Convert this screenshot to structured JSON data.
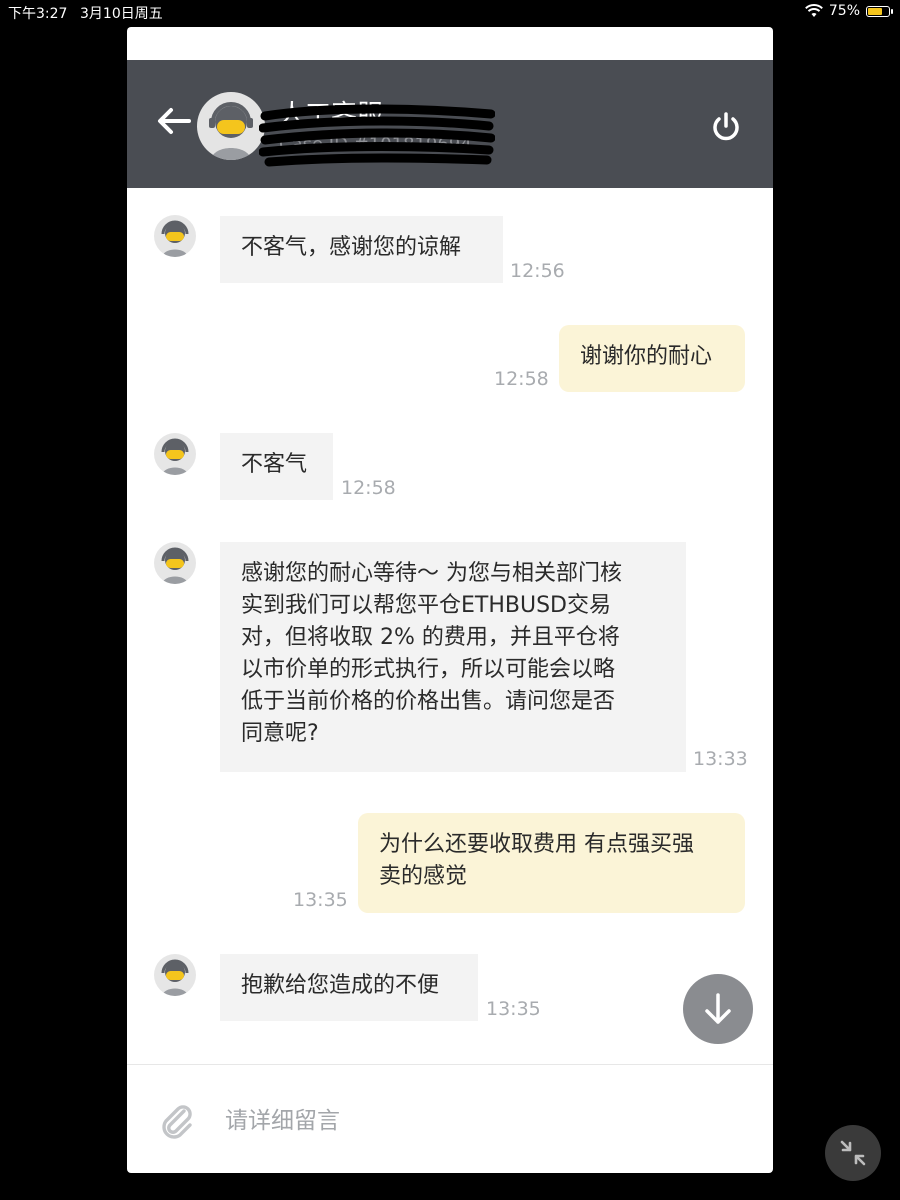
{
  "status_bar": {
    "time": "下午3:27",
    "date": "3月10日周五",
    "battery": "75%",
    "battery_level": 0.75
  },
  "header": {
    "back_icon": "arrow-left-icon",
    "agent_name": "人工客服",
    "case_id": "Case ID #101819694",
    "power_icon": "power-icon"
  },
  "messages": [
    {
      "side": "in",
      "lines": [
        "不客气，感谢您的谅解"
      ],
      "time": "12:56"
    },
    {
      "side": "out",
      "lines": [
        "谢谢你的耐心"
      ],
      "time": "12:58"
    },
    {
      "side": "in",
      "lines": [
        "不客气"
      ],
      "time": "12:58"
    },
    {
      "side": "in",
      "lines": [
        "感谢您的耐心等待～ 为您与相关部门核",
        "实到我们可以帮您平仓ETHBUSD交易",
        "对，但将收取 2% 的费用，并且平仓将",
        "以市价单的形式执行，所以可能会以略",
        "低于当前价格的价格出售。请问您是否",
        "同意呢?"
      ],
      "time": "13:33"
    },
    {
      "side": "out",
      "lines": [
        "为什么还要收取费用 有点强买强",
        "卖的感觉"
      ],
      "time": "13:35"
    },
    {
      "side": "in",
      "lines": [
        "抱歉给您造成的不便"
      ],
      "time": "13:35"
    }
  ],
  "composer": {
    "placeholder": "请详细留言",
    "attach_icon": "paperclip-icon"
  },
  "colors": {
    "header_bg": "#4a4d53",
    "incoming_bubble": "#f3f3f3",
    "outgoing_bubble": "#fbf4d7",
    "accent": "#f4c51d"
  }
}
